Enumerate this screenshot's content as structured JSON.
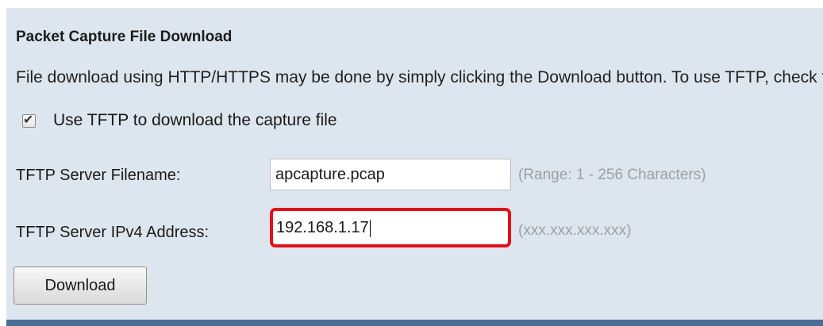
{
  "section": {
    "title": "Packet Capture File Download",
    "description": "File download using HTTP/HTTPS may be done by simply clicking the Download button. To use TFTP, check the box below."
  },
  "tftp_checkbox": {
    "label": "Use TFTP to download the capture file",
    "checked": true
  },
  "filename": {
    "label": "TFTP Server Filename:",
    "value": "apcapture.pcap",
    "hint": "(Range: 1 - 256 Characters)"
  },
  "ipv4": {
    "label": "TFTP Server IPv4 Address:",
    "value": "192.168.1.17",
    "hint": "(xxx.xxx.xxx.xxx)",
    "highlight_color": "#e0101a"
  },
  "download_button": {
    "label": "Download"
  },
  "colors": {
    "panel_background": "#dde6ef",
    "bottom_bar": "#4a6d95",
    "hint_text": "#9aa0a6"
  }
}
